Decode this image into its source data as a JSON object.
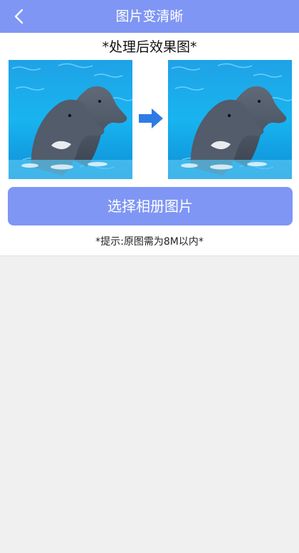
{
  "header": {
    "title": "图片变清晰",
    "back_icon": "chevron-left-icon"
  },
  "main": {
    "caption": "*处理后效果图*",
    "before_image": "dolphin-photo",
    "after_image": "dolphin-photo",
    "arrow_icon": "arrow-right-icon",
    "choose_button": "选择相册图片",
    "tip": "*提示:原图需为8M以内*"
  },
  "colors": {
    "accent": "#7f96f4",
    "arrow": "#2f7be6",
    "background": "#f0f0f0"
  }
}
